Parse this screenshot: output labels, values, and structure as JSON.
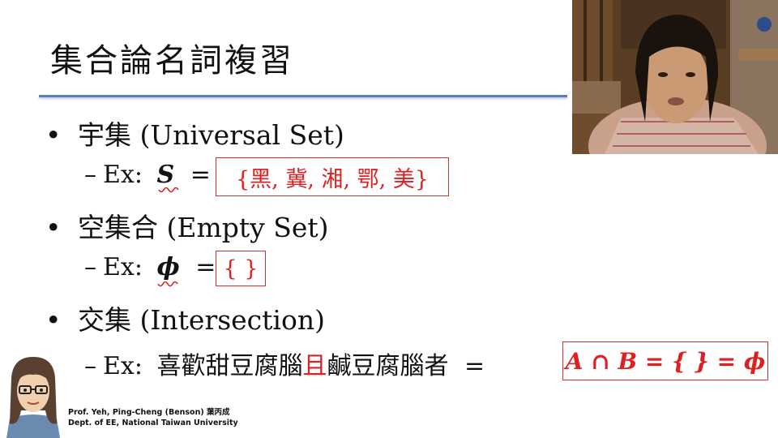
{
  "slide": {
    "title": "集合論名詞複習"
  },
  "bullets": [
    {
      "label": "宇集 (Universal Set)",
      "example_prefix": "Ex:",
      "symbol": "S",
      "equals": "=",
      "set_value": "{黑, 冀, 湘, 鄂, 美}"
    },
    {
      "label": "空集合 (Empty Set)",
      "example_prefix": "Ex:",
      "symbol": "ϕ",
      "equals": "=",
      "set_value": "{ }"
    },
    {
      "label": "交集 (Intersection)",
      "example_prefix": "Ex:",
      "phrase_part1": "喜歡甜豆腐腦",
      "phrase_conj": "且",
      "phrase_part2": "鹹豆腐腦者",
      "equals": "=",
      "result": "A ∩ B = { } = ϕ"
    }
  ],
  "footer": {
    "line1": "Prof. Yeh, Ping-Cheng (Benson) 葉丙成",
    "line2": "Dept. of EE,  National Taiwan University"
  },
  "colors": {
    "accent_red": "#e02020",
    "title_rule": "#5b7fb5"
  }
}
